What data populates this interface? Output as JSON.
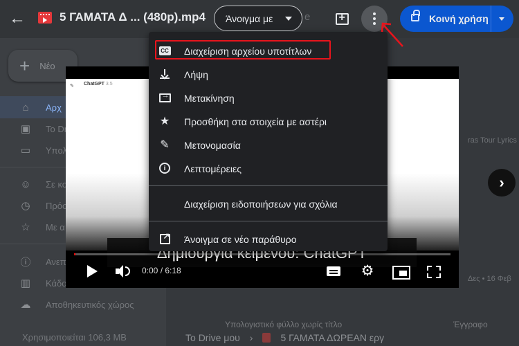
{
  "header": {
    "file_title": "5 ΓΑΜΑΤΑ Δ ... (480p).mp4",
    "open_with_label": "Άνοιγμα με",
    "share_label": "Κοινή χρήση"
  },
  "sidebar": {
    "new_label": "Νέο",
    "items": [
      {
        "label": "Αρχ",
        "icon": "home-icon"
      },
      {
        "label": "Το Dri",
        "icon": "drive-icon"
      },
      {
        "label": "Υπολ",
        "icon": "computer-icon"
      },
      {
        "label": "Σε κο",
        "icon": "people-icon"
      },
      {
        "label": "Πρόσ",
        "icon": "clock-icon"
      },
      {
        "label": "Με α",
        "icon": "star-icon"
      },
      {
        "label": "Ανεπ",
        "icon": "spam-icon"
      },
      {
        "label": "Κάδο",
        "icon": "trash-icon"
      },
      {
        "label": "Αποθηκευτικός χώρος",
        "icon": "cloud-icon"
      }
    ],
    "storage_text": "Χρησιμοποιείται 106,3 MB"
  },
  "breadcrumb": {
    "root": "Το Drive μου",
    "current": "5 ΓΑΜΑΤΑ ΔΩΡΕΑΝ εργ"
  },
  "background_text": {
    "lyrics": "ras Tour Lyrics",
    "date": "Δες • 16 Φεβ",
    "file_row": "Υπολογιστικό φύλλο χωρίς τίτλο",
    "file_row2": "Έγγραφο"
  },
  "video": {
    "frame_app_name": "ChatGPT",
    "frame_app_version": "3.5",
    "subtitle": "Δημιουργία κειμένου: ChatGPT",
    "timecode": "0:00 / 6:18",
    "progress": 0.003
  },
  "menu": {
    "items": [
      {
        "label": "Διαχείριση αρχείου υποτίτλων",
        "icon": "closed-captions-icon"
      },
      {
        "label": "Λήψη",
        "icon": "download-icon"
      },
      {
        "label": "Μετακίνηση",
        "icon": "move-folder-icon"
      },
      {
        "label": "Προσθήκη στα στοιχεία με αστέρι",
        "icon": "star-icon"
      },
      {
        "label": "Μετονομασία",
        "icon": "rename-icon"
      },
      {
        "label": "Λεπτομέρειες",
        "icon": "info-icon"
      },
      {
        "label": "Διαχείριση ειδοποιήσεων για σχόλια",
        "icon": ""
      },
      {
        "label": "Άνοιγμα σε νέο παράθυρο",
        "icon": "open-in-new-icon"
      }
    ]
  },
  "colors": {
    "accent": "#0b57d0",
    "highlight": "#e8141c",
    "menu_bg": "#202124"
  }
}
